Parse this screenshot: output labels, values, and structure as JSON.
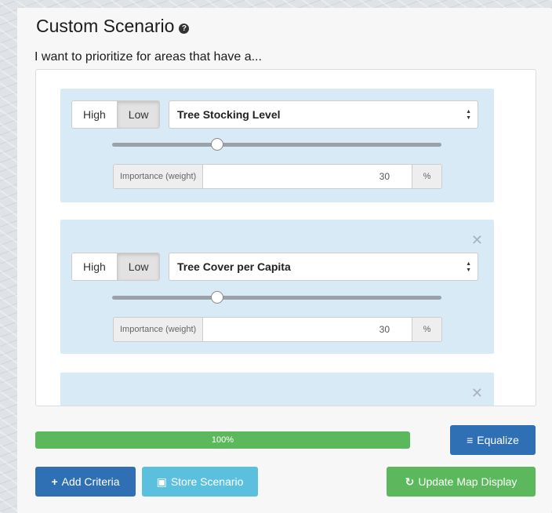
{
  "header": {
    "title": "Custom Scenario",
    "subtitle": "I want to prioritize for areas that have a..."
  },
  "criteria": [
    {
      "high_label": "High",
      "low_label": "Low",
      "active": "Low",
      "selected_metric": "Tree Stocking Level",
      "slider_value": 0.32,
      "weight_label": "Importance (weight)",
      "weight_value": "30",
      "weight_unit": "%",
      "removable": false
    },
    {
      "high_label": "High",
      "low_label": "Low",
      "active": "Low",
      "selected_metric": "Tree Cover per Capita",
      "slider_value": 0.32,
      "weight_label": "Importance (weight)",
      "weight_value": "30",
      "weight_unit": "%",
      "removable": true
    }
  ],
  "progress": {
    "value_percent": 100,
    "label": "100%"
  },
  "actions": {
    "equalize_label": "Equalize",
    "add_label": "Add Criteria",
    "store_label": "Store Scenario",
    "update_label": "Update Map Display"
  },
  "colors": {
    "primary": "#2f70b5",
    "info": "#5bc0de",
    "success": "#5cb85c",
    "card_bg": "#d9eaf7"
  },
  "icons": {
    "help": "question-circle-icon",
    "remove": "close-icon",
    "equalize": "align-icon",
    "add": "plus-icon",
    "store": "save-icon",
    "update": "refresh-icon"
  }
}
